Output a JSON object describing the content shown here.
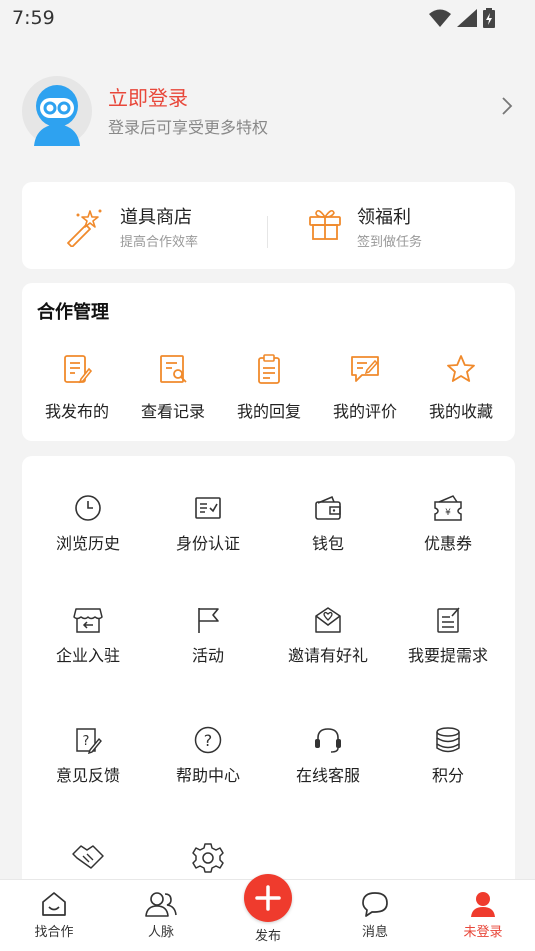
{
  "status_bar": {
    "time": "7:59"
  },
  "profile": {
    "login_title": "立即登录",
    "login_subtitle": "登录后可享受更多特权"
  },
  "tools": [
    {
      "title": "道具商店",
      "subtitle": "提高合作效率"
    },
    {
      "title": "领福利",
      "subtitle": "签到做任务"
    }
  ],
  "coop": {
    "title": "合作管理",
    "items": [
      "我发布的",
      "查看记录",
      "我的回复",
      "我的评价",
      "我的收藏"
    ]
  },
  "grid": {
    "items": [
      "浏览历史",
      "身份认证",
      "钱包",
      "优惠券",
      "企业入驻",
      "活动",
      "邀请有好礼",
      "我要提需求",
      "意见反馈",
      "帮助中心",
      "在线客服",
      "积分"
    ]
  },
  "tabbar": {
    "items": [
      "找合作",
      "人脉",
      "发布",
      "消息",
      "未登录"
    ],
    "active_index": 4
  },
  "colors": {
    "accent": "#e8473a",
    "orange_icon": "#f08a2c",
    "avatar_blue": "#2ea2f0"
  }
}
